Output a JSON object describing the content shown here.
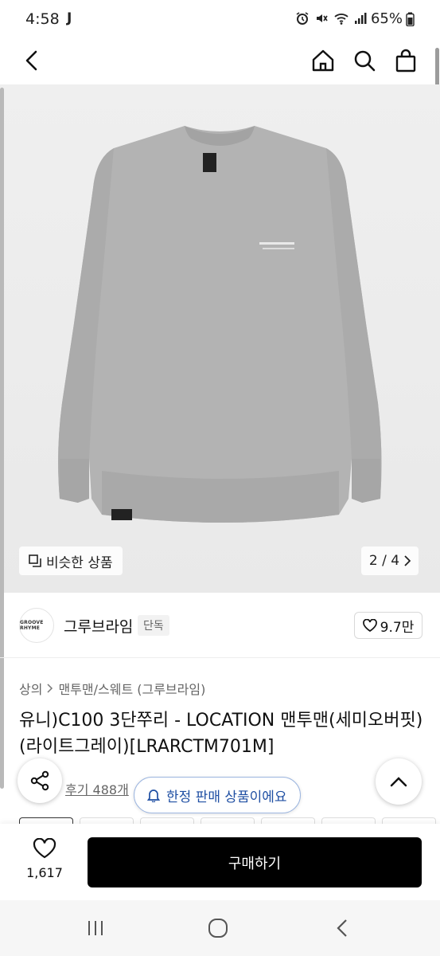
{
  "status_bar": {
    "time": "4:58",
    "notif": "J",
    "battery": "65%"
  },
  "header": {
    "back_icon": "chevron-left-icon",
    "home_icon": "home-icon",
    "search_icon": "search-icon",
    "cart_icon": "shopping-bag-icon"
  },
  "gallery": {
    "similar_label": "비슷한 상품",
    "page_indicator": "2 / 4"
  },
  "brand": {
    "logo_text": "GROOVE RHYME",
    "name": "그루브라임",
    "badge": "단독",
    "likes": "9.7만"
  },
  "product": {
    "breadcrumb": [
      "상의",
      "맨투맨/스웨트 (그루브라임)"
    ],
    "title": "유니)C100 3단쭈리 - LOCATION 맨투맨(세미오버핏)(라이트그레이)[LRARCTM701M]",
    "reviews": "후기 488개",
    "limited_label": "한정 판매 상품이에요"
  },
  "purchase": {
    "wish_count": "1,617",
    "buy_label": "구매하기"
  },
  "colors": {
    "buy_button": "#000000",
    "limited_text": "#1f4fa3",
    "sweatshirt": "#b3b3b3"
  }
}
